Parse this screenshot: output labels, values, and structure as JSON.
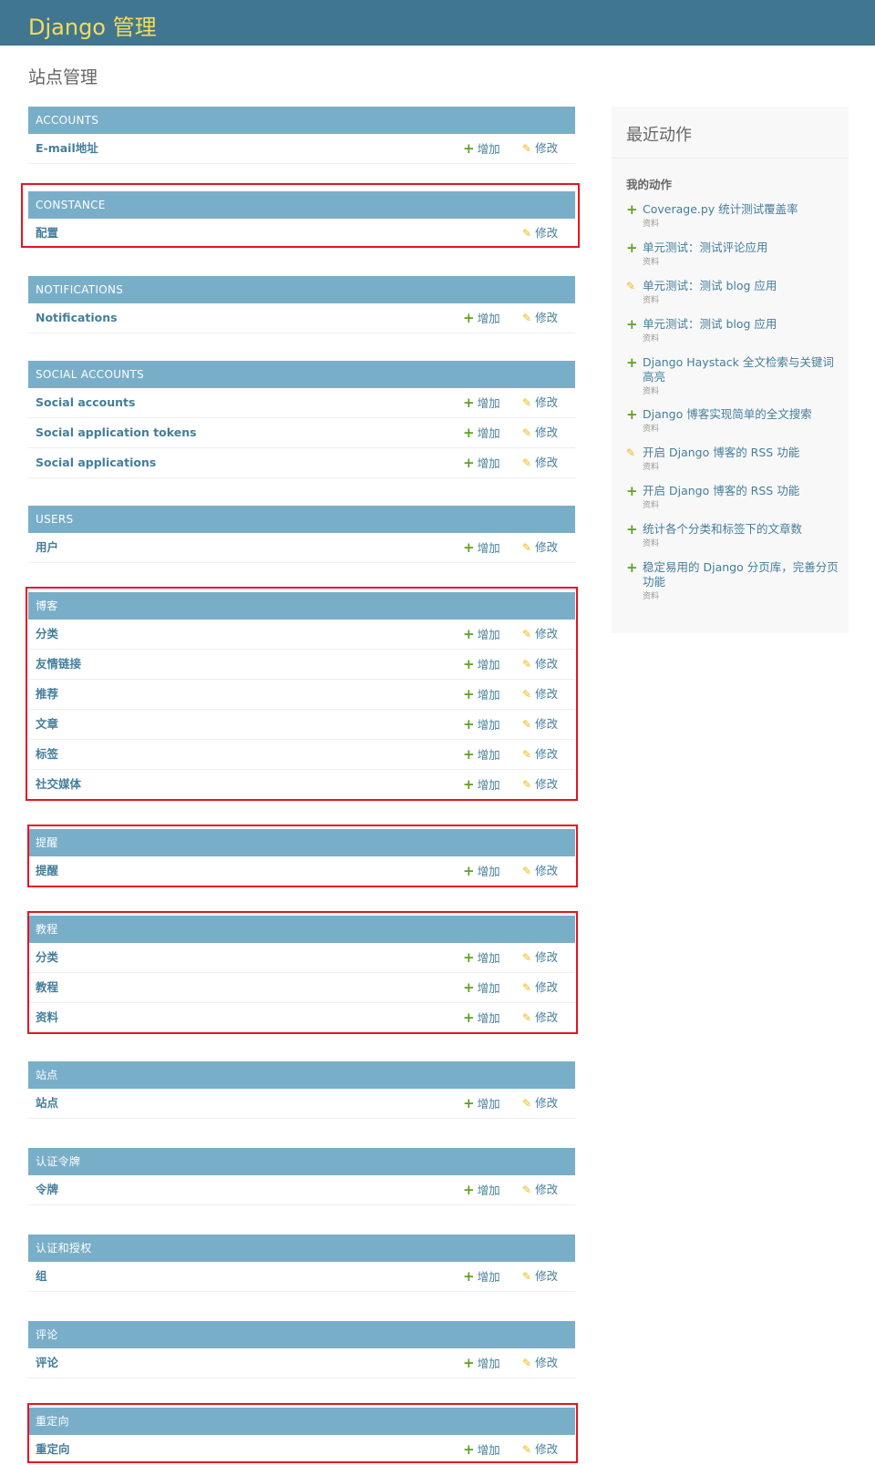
{
  "header": {
    "site_name": "Django 管理"
  },
  "page_title": "站点管理",
  "add_label": "增加",
  "change_label": "修改",
  "apps": [
    {
      "caption": "ACCOUNTS",
      "models": [
        "E-mail地址"
      ],
      "has_add": [
        true
      ]
    },
    {
      "caption": "CONSTANCE",
      "models": [
        "配置"
      ],
      "has_add": [
        false
      ]
    },
    {
      "caption": "NOTIFICATIONS",
      "models": [
        "Notifications"
      ],
      "has_add": [
        true
      ]
    },
    {
      "caption": "SOCIAL ACCOUNTS",
      "models": [
        "Social accounts",
        "Social application tokens",
        "Social applications"
      ],
      "has_add": [
        true,
        true,
        true
      ]
    },
    {
      "caption": "USERS",
      "models": [
        "用户"
      ],
      "has_add": [
        true
      ]
    },
    {
      "caption": "博客",
      "models": [
        "分类",
        "友情链接",
        "推荐",
        "文章",
        "标签",
        "社交媒体"
      ],
      "has_add": [
        true,
        true,
        true,
        true,
        true,
        true
      ]
    },
    {
      "caption": "提醒",
      "models": [
        "提醒"
      ],
      "has_add": [
        true
      ]
    },
    {
      "caption": "教程",
      "models": [
        "分类",
        "教程",
        "资料"
      ],
      "has_add": [
        true,
        true,
        true
      ]
    },
    {
      "caption": "站点",
      "models": [
        "站点"
      ],
      "has_add": [
        true
      ]
    },
    {
      "caption": "认证令牌",
      "models": [
        "令牌"
      ],
      "has_add": [
        true
      ]
    },
    {
      "caption": "认证和授权",
      "models": [
        "组"
      ],
      "has_add": [
        true
      ]
    },
    {
      "caption": "评论",
      "models": [
        "评论"
      ],
      "has_add": [
        true
      ]
    },
    {
      "caption": "重定向",
      "models": [
        "重定向"
      ],
      "has_add": [
        true
      ]
    }
  ],
  "recent_actions": {
    "title": "最近动作",
    "subtitle": "我的动作",
    "items": [
      {
        "icon": "plus-icon",
        "text": "Coverage.py 统计测试覆盖率",
        "type": "资料"
      },
      {
        "icon": "plus-icon",
        "text": "单元测试：测试评论应用",
        "type": "资料"
      },
      {
        "icon": "pencil-icon",
        "text": "单元测试：测试 blog 应用",
        "type": "资料"
      },
      {
        "icon": "plus-icon",
        "text": "单元测试：测试 blog 应用",
        "type": "资料"
      },
      {
        "icon": "plus-icon",
        "text": "Django Haystack 全文检索与关键词高亮",
        "type": "资料"
      },
      {
        "icon": "plus-icon",
        "text": "Django 博客实现简单的全文搜索",
        "type": "资料"
      },
      {
        "icon": "pencil-icon",
        "text": "开启 Django 博客的 RSS 功能",
        "type": "资料"
      },
      {
        "icon": "plus-icon",
        "text": "开启 Django 博客的 RSS 功能",
        "type": "资料"
      },
      {
        "icon": "plus-icon",
        "text": "统计各个分类和标签下的文章数",
        "type": "资料"
      },
      {
        "icon": "plus-icon",
        "text": "稳定易用的 Django 分页库，完善分页功能",
        "type": "资料"
      }
    ]
  },
  "colors": {
    "header_bg": "#417690",
    "site_name": "#f5dd5d",
    "caption_bg": "#79aec8",
    "link": "#447e9b",
    "add_icon": "#5fa225",
    "change_icon": "#efb80b",
    "highlight": "#e8131f"
  }
}
